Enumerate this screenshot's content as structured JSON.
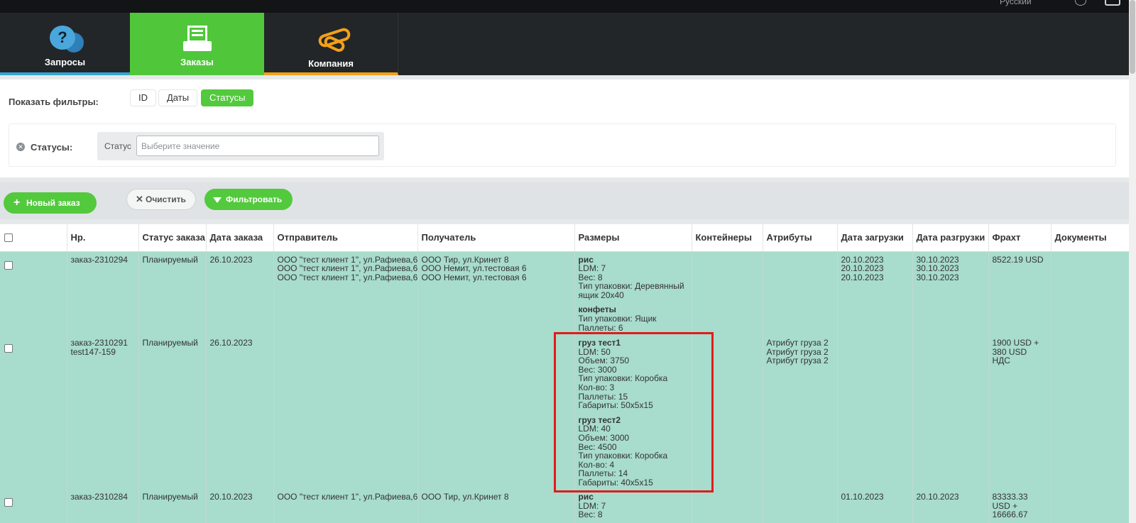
{
  "header": {
    "language": "Русский",
    "icons": [
      "globe-icon",
      "exit-icon"
    ]
  },
  "nav": {
    "tabs": [
      {
        "label": "Запросы",
        "icon": "chat-bubbles-icon",
        "accent": "#37a3d4"
      },
      {
        "label": "Заказы",
        "icon": "inbox-tray-icon",
        "accent": "#50c73a",
        "active": true
      },
      {
        "label": "Компания",
        "icon": "handshake-icon",
        "accent": "#f3a019"
      }
    ]
  },
  "filters": {
    "show_label": "Показать фильтры:",
    "buttons": [
      "ID",
      "Даты",
      "Статусы"
    ],
    "status_label": "Статусы:",
    "status_caption": "Статус",
    "status_value": "",
    "status_placeholder": "Выберите значение"
  },
  "actions": {
    "new_order": "Новый заказ",
    "clear": "Очистить",
    "filter": "Фильтровать"
  },
  "table": {
    "columns": [
      "Нр.",
      "Статус заказа",
      "Дата заказа",
      "Отправитель",
      "Получатель",
      "Размеры",
      "Контейнеры",
      "Атрибуты",
      "Дата загрузки",
      "Дата разгрузки",
      "Фрахт",
      "Документы"
    ],
    "rows": [
      {
        "number": [
          "заказ-2310294"
        ],
        "status": "Планируемый",
        "date": "26.10.2023",
        "sender": [
          "ООО \"тест клиент 1\", ул.Рафиева,6",
          "ООО \"тест клиент 1\", ул.Рафиева,6",
          "ООО \"тест клиент 1\", ул.Рафиева,6"
        ],
        "receiver": [
          "ООО Тир, ул.Кринет 8",
          "ООО Немит, ул.тестовая 6",
          "ООО Немит, ул.тестовая 6"
        ],
        "cargo": [
          {
            "name": "рис",
            "lines": [
              "LDM: 7",
              "Вес: 8",
              "Тип упаковки: Деревянный ящик 20х40"
            ]
          },
          {
            "name": "конфеты",
            "lines": [
              "Тип упаковки: Ящик",
              "Паллеты: 6"
            ]
          }
        ],
        "containers": "",
        "attributes": [],
        "load_dates": [
          "20.10.2023",
          "20.10.2023",
          "20.10.2023"
        ],
        "unload_dates": [
          "30.10.2023",
          "30.10.2023",
          "30.10.2023"
        ],
        "freight": [
          "8522.19 USD"
        ],
        "documents": ""
      },
      {
        "number": [
          "заказ-2310291",
          "test147-159"
        ],
        "status": "Планируемый",
        "date": "26.10.2023",
        "sender": [],
        "receiver": [],
        "cargo": [
          {
            "name": "груз тест1",
            "lines": [
              "LDM: 50",
              "Объем: 3750",
              "Вес: 3000",
              "Тип упаковки: Коробка",
              "Кол-во: 3",
              "Паллеты: 15",
              "Габариты: 50х5х15"
            ]
          },
          {
            "name": "груз тест2",
            "lines": [
              "LDM: 40",
              "Объем: 3000",
              "Вес: 4500",
              "Тип упаковки: Коробка",
              "Кол-во: 4",
              "Паллеты: 14",
              "Габариты: 40х5х15"
            ]
          }
        ],
        "containers": "",
        "attributes": [
          "Атрибут груза 2",
          "Атрибут груза 2",
          "Атрибут груза 2"
        ],
        "load_dates": [],
        "unload_dates": [],
        "freight": [
          "1900 USD +",
          "380 USD",
          "НДС"
        ],
        "documents": ""
      },
      {
        "number": [
          "заказ-2310284"
        ],
        "status": "Планируемый",
        "date": "20.10.2023",
        "sender": [
          "ООО \"тест клиент 1\", ул.Рафиева,6"
        ],
        "receiver": [
          "ООО Тир, ул.Кринет 8"
        ],
        "cargo": [
          {
            "name": "рис",
            "lines": [
              "LDM: 7",
              "Вес: 8"
            ]
          }
        ],
        "containers": "",
        "attributes": [],
        "load_dates": [
          "01.10.2023"
        ],
        "unload_dates": [
          "20.10.2023"
        ],
        "freight": [
          "83333.33",
          "USD +",
          "16666.67"
        ],
        "documents": ""
      }
    ]
  },
  "colors": {
    "active_green": "#50c73a",
    "row_teal": "#a8dccd",
    "highlight_red": "#e11b1b"
  }
}
